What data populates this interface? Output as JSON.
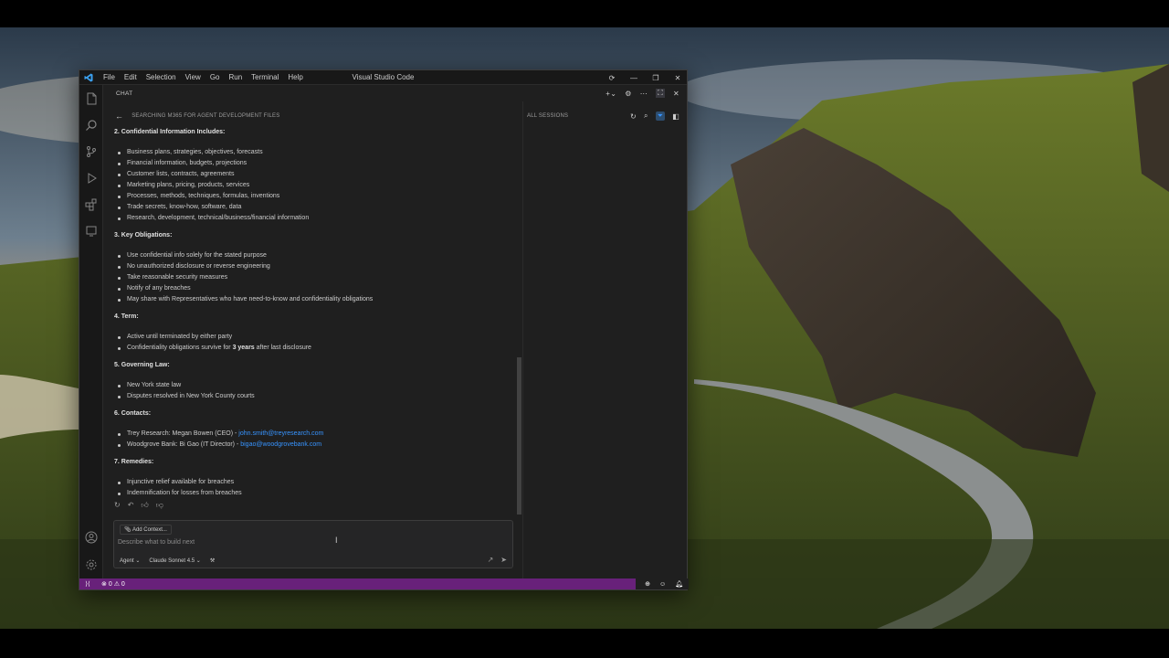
{
  "window": {
    "title": "Visual Studio Code",
    "menu": [
      "File",
      "Edit",
      "Selection",
      "View",
      "Go",
      "Run",
      "Terminal",
      "Help"
    ]
  },
  "chat": {
    "header_label": "CHAT",
    "session_title": "SEARCHING M365 FOR AGENT DEVELOPMENT FILES",
    "sections": [
      {
        "title": "2. Confidential Information Includes:",
        "items": [
          "Business plans, strategies, objectives, forecasts",
          "Financial information, budgets, projections",
          "Customer lists, contracts, agreements",
          "Marketing plans, pricing, products, services",
          "Processes, methods, techniques, formulas, inventions",
          "Trade secrets, know-how, software, data",
          "Research, development, technical/business/financial information"
        ]
      },
      {
        "title": "3. Key Obligations:",
        "items": [
          "Use confidential info solely for the stated purpose",
          "No unauthorized disclosure or reverse engineering",
          "Take reasonable security measures",
          "Notify of any breaches",
          "May share with Representatives who have need-to-know and confidentiality obligations"
        ]
      },
      {
        "title": "4. Term:",
        "items": [
          "Active until terminated by either party"
        ],
        "survive": {
          "pre": "Confidentiality obligations survive for ",
          "bold": "3 years",
          "post": " after last disclosure"
        }
      },
      {
        "title": "5. Governing Law:",
        "items": [
          "New York state law",
          "Disputes resolved in New York County courts"
        ]
      },
      {
        "title": "6. Contacts:",
        "contacts": [
          {
            "text": "Trey Research: Megan Bowen (CEO) - ",
            "email": "john.smith@treyresearch.com"
          },
          {
            "text": "Woodgrove Bank: Bi Gao (IT Director) - ",
            "email": "bigao@woodgrovebank.com"
          }
        ]
      },
      {
        "title": "7. Remedies:",
        "items": [
          "Injunctive relief available for breaches",
          "Indemnification for losses from breaches"
        ]
      }
    ],
    "input": {
      "add_context": "Add Context...",
      "placeholder": "Describe what to build next",
      "mode": "Agent",
      "model": "Claude Sonnet 4.5"
    }
  },
  "sessions": {
    "label": "ALL SESSIONS"
  },
  "status": {
    "errors": "0",
    "warnings": "0"
  },
  "icons": {
    "activity": [
      "explorer-icon",
      "search-icon",
      "source-control-icon",
      "run-debug-icon",
      "extensions-icon",
      "remote-explorer-icon",
      "account-icon",
      "settings-gear-icon"
    ]
  },
  "colors": {
    "statusbar": "#68217a",
    "link": "#3794ff",
    "editor_bg": "#1f1f1f"
  }
}
